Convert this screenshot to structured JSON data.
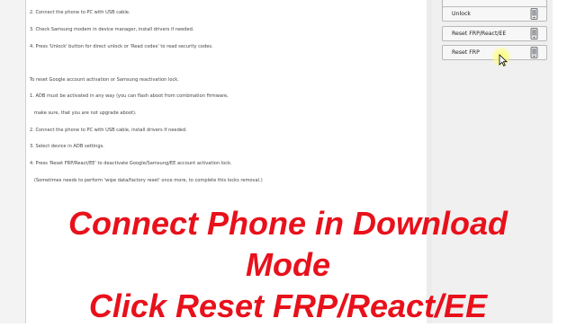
{
  "log": {
    "lines": [
      "2. Connect the phone to PC with USB cable.",
      "3. Check Samsung modem in device manager, install drivers if needed.",
      "4. Press 'Unlock' button for direct unlock or 'Read codes' to read security codes.",
      "",
      "To reset Google account activation or Samsung reactivation lock.",
      "1. ADB must be activated in any way (you can flash aboot from combination firmware,",
      "   make sure, that you are not upgrade aboot).",
      "2. Connect the phone to PC with USB cable, install drivers if needed.",
      "3. Select device in ADB settings.",
      "4. Press 'Reset FRP/React/EE' to deactivate Google/Samsung/EE account activation lock.",
      "   (Sometimes needs to perform 'wipe data/factory reset' once more, to complete this locks removal.)"
    ]
  },
  "buttons": {
    "unlock": "Unlock",
    "reset_frp_react_ee": "Reset FRP/React/EE",
    "reset_frp": "Reset FRP",
    "icon": "phone-icon"
  },
  "overlay": {
    "line1": "Connect Phone in Download",
    "line2": "Mode",
    "line3": "Click Reset FRP/React/EE"
  },
  "colors": {
    "overlay_text": "#e8111b"
  }
}
